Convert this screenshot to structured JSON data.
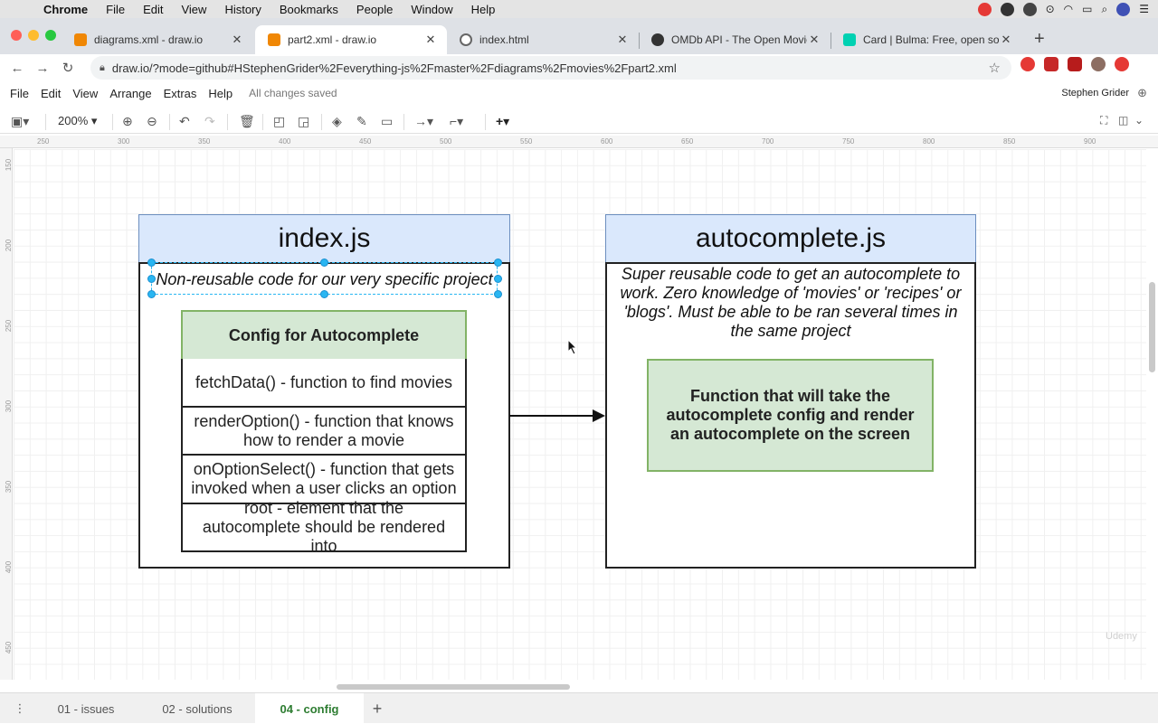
{
  "macos": {
    "app_name": "Chrome",
    "menus": [
      "File",
      "Edit",
      "View",
      "History",
      "Bookmarks",
      "People",
      "Window",
      "Help"
    ]
  },
  "browser": {
    "tabs": [
      {
        "title": "diagrams.xml - draw.io",
        "active": false
      },
      {
        "title": "part2.xml - draw.io",
        "active": true
      },
      {
        "title": "index.html",
        "active": false
      },
      {
        "title": "OMDb API - The Open Movie D",
        "active": false
      },
      {
        "title": "Card | Bulma: Free, open sourc",
        "active": false
      }
    ],
    "url": "draw.io/?mode=github#HStephenGrider%2Feverything-js%2Fmaster%2Fdiagrams%2Fmovies%2Fpart2.xml"
  },
  "drawio": {
    "menus": [
      "File",
      "Edit",
      "View",
      "Arrange",
      "Extras",
      "Help"
    ],
    "status": "All changes saved",
    "user": "Stephen Grider",
    "zoom": "200%",
    "ruler_top": [
      "250",
      "300",
      "350",
      "400",
      "450",
      "500",
      "550",
      "600",
      "650",
      "700",
      "750",
      "800",
      "850",
      "900"
    ],
    "ruler_left": [
      "150",
      "200",
      "250",
      "300",
      "350",
      "400",
      "450"
    ],
    "pages": [
      "01 - issues",
      "02 - solutions",
      "04 - config"
    ],
    "active_page": "04 - config",
    "watermark": "Udemy"
  },
  "diagram": {
    "left": {
      "title": "index.js",
      "description": "Non-reusable code for our very specific project",
      "config_title": "Config for Autocomplete",
      "rows": [
        "fetchData() - function to find movies",
        "renderOption() - function that knows how to render a movie",
        "onOptionSelect() - function that gets invoked when a user clicks an option",
        "root - element that the autocomplete should be rendered into"
      ]
    },
    "right": {
      "title": "autocomplete.js",
      "description": "Super reusable code to get an autocomplete to work.  Zero knowledge of 'movies' or 'recipes' or 'blogs'.  Must be able to be ran several times in the same project",
      "function_box": "Function that will take the autocomplete config and render an autocomplete on the screen"
    }
  }
}
